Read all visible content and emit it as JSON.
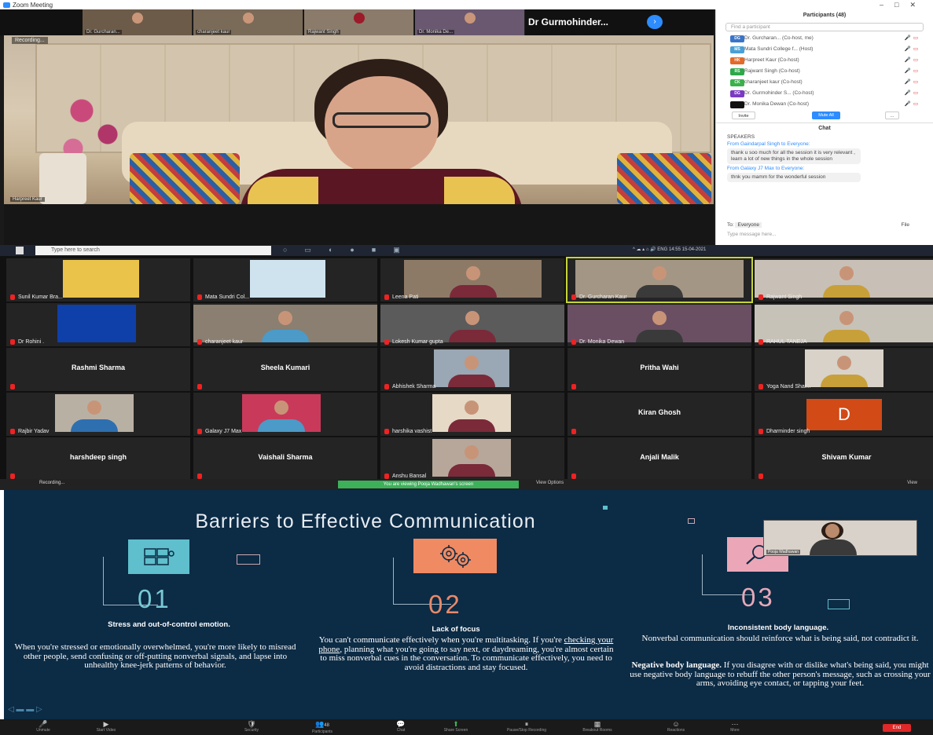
{
  "window": {
    "title": "Zoom Meeting"
  },
  "top_strip": {
    "thumbs": [
      "Dr. Gurcharan...",
      "charanjeet kaur",
      "Rajwant Singh",
      "Dr. Monika De..."
    ],
    "featured_name": "Dr Gurmohinder...",
    "main_label": "Harpreet Kaur",
    "recording_label": "Recording..."
  },
  "participants": {
    "header": "Participants (48)",
    "search_placeholder": "Find a participant",
    "rows": [
      {
        "initials": "DG",
        "name": "Dr. Gurcharan... (Co-host, me)",
        "color": "#3a74c8"
      },
      {
        "initials": "MS",
        "name": "Mata Sundri College f... (Host)",
        "color": "#4aa0d6"
      },
      {
        "initials": "HK",
        "name": "Harpreet Kaur (Co-host)",
        "color": "#e36a2a"
      },
      {
        "initials": "RS",
        "name": "Rajwant Singh (Co-host)",
        "color": "#2ea84a"
      },
      {
        "initials": "CK",
        "name": "charanjeet kaur (Co-host)",
        "color": "#3bb04c"
      },
      {
        "initials": "DG",
        "name": "Dr. Gurmohinder S... (Co-host)",
        "color": "#7a3ac2"
      },
      {
        "initials": "",
        "name": "Dr. Monika Dewan (Co-host)",
        "color": "#111111"
      }
    ],
    "invite_label": "Invite",
    "mute_all_label": "Mute All",
    "more_label": "..."
  },
  "chat": {
    "header": "Chat",
    "prev_line": "SPEAKERS",
    "messages": [
      {
        "from": "From Gaindarpal Singh to Everyone:",
        "text": "thank u soo much for all the session it is very relevant , learn a lot of new things in the whole session"
      },
      {
        "from": "From Galaxy J7 Max to Everyone:",
        "text": "thnk you mamm for the wonderful session"
      }
    ],
    "to_label": "To:",
    "to_value": "Everyone",
    "file_label": "File",
    "input_placeholder": "Type message here..."
  },
  "taskbar": {
    "search_placeholder": "Type here to search",
    "time": "14:55",
    "date": "15-04-2021",
    "lang": "ENG"
  },
  "gallery": {
    "tiles": [
      {
        "name": "Sunil Kumar Bra..."
      },
      {
        "name": "Mata Sundri Col..."
      },
      {
        "name": "Leena Pati"
      },
      {
        "name": "Dr. Gurcharan Kaur"
      },
      {
        "name": "Rajwant Singh"
      },
      {
        "name": "Dr Rohini ."
      },
      {
        "name": "charanjeet kaur"
      },
      {
        "name": "Lokesh Kumar gupta"
      },
      {
        "name": "Dr. Monika Dewan"
      },
      {
        "name": "RAHUL TANEJA"
      },
      {
        "name": "Rashmi Sharma"
      },
      {
        "name": "Sheela Kumari"
      },
      {
        "name": "Abhishek Sharma"
      },
      {
        "name": "Pritha Wahi"
      },
      {
        "name": "Yoga Nand Shar..."
      },
      {
        "name": "Rajbir Yadav"
      },
      {
        "name": "Galaxy J7 Max"
      },
      {
        "name": "harshika vashist"
      },
      {
        "name": "Kiran Ghosh"
      },
      {
        "name": "Dharminder singh"
      },
      {
        "name": "harshdeep singh"
      },
      {
        "name": "Vaishali Sharma"
      },
      {
        "name": "Anshu Bansal"
      },
      {
        "name": "Anjali Malik"
      },
      {
        "name": "Shivam Kumar"
      }
    ],
    "avatar_letter": "D"
  },
  "share_bar": {
    "status": "You are viewing Pooja Wadhawan's screen",
    "view_options": "View Options",
    "recording": "Recording...",
    "view": "View"
  },
  "slide": {
    "title": "Barriers to Effective Communication",
    "items": [
      {
        "num": "01",
        "heading": "Stress and out-of-control emotion.",
        "body": "When you're stressed or emotionally overwhelmed, you're more likely to misread other people, send confusing or off-putting nonverbal signals, and lapse into unhealthy knee-jerk patterns of behavior.",
        "color": "#79c9d4",
        "box_color": "#5fbfcc"
      },
      {
        "num": "02",
        "heading": "Lack of focus",
        "body_pre": "You can't communicate effectively when you're multitasking. If you're ",
        "body_link": "checking your phone",
        "body_post": ", planning what you're going to say next, or daydreaming, you're almost certain to miss nonverbal cues in the conversation. To communicate effectively, you need to avoid distractions and stay focused.",
        "color": "#e88a6a",
        "box_color": "#ef8a63"
      },
      {
        "num": "03",
        "heading": "Inconsistent body language.",
        "body1": "Nonverbal communication should reinforce what is being said, not contradict it.",
        "body2_bold": "Negative body language.",
        "body2": " If you disagree with or dislike what's being said, you might use negative body language to rebuff the other person's message, such as crossing your arms, avoiding eye contact, or tapping your feet.",
        "color": "#e6a8b8",
        "box_color": "#eba7b7"
      }
    ],
    "pip_name": "Pooja Wadhawan"
  },
  "toolbar": {
    "items": [
      "Unmute",
      "Start Video",
      "Security",
      "Participants",
      "Chat",
      "Share Screen",
      "Pause/Stop Recording",
      "Breakout Rooms",
      "Reactions",
      "More"
    ],
    "participants_count": "48",
    "end_label": "End"
  }
}
